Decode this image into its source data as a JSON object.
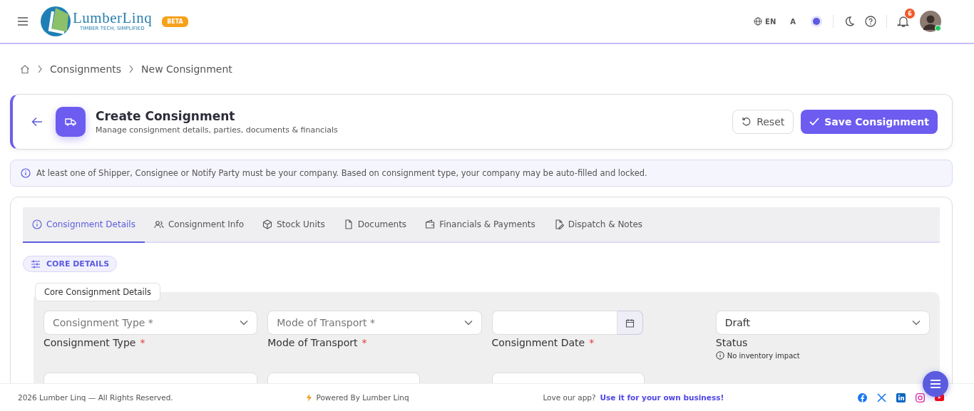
{
  "header": {
    "logo_name": "LumberLinq",
    "logo_tagline": "TIMBER TECH, SIMPLIFIED",
    "badge": "BETA",
    "language": "EN",
    "font_size_label": "A",
    "notifications": "6",
    "avatar_online": true
  },
  "breadcrumb": [
    "Consignments",
    "New Consignment"
  ],
  "page": {
    "title": "Create Consignment",
    "subtitle": "Manage consignment details, parties, documents & financials",
    "buttons": [
      {
        "label": "Reset",
        "kind": "secondary"
      },
      {
        "label": "Save Consignment",
        "kind": "primary"
      }
    ]
  },
  "notice": "At least one of Shipper, Consignee or Notify Party must be your company. Based on consignment type, your company may be auto-filled and locked.",
  "tabs": [
    {
      "label": "Consignment Details",
      "selected": true
    },
    {
      "label": "Consignment Info",
      "selected": false
    },
    {
      "label": "Stock Units",
      "selected": false
    },
    {
      "label": "Documents",
      "selected": false
    },
    {
      "label": "Financials & Payments",
      "selected": false
    },
    {
      "label": "Dispatch & Notes",
      "selected": false
    }
  ],
  "section_chip": "CORE DETAILS",
  "group_title": "Core Consignment Details",
  "fields": [
    {
      "kind": "select",
      "placeholder": "Consignment Type *",
      "label": "Consignment Type",
      "required_mark": "*"
    },
    {
      "kind": "select",
      "placeholder": "Mode of Transport *",
      "label": "Mode of Transport",
      "required_mark": "*"
    },
    {
      "kind": "date",
      "label": "Consignment Date",
      "required_mark": "*"
    },
    {
      "kind": "select",
      "value": "Draft",
      "label": "Status",
      "hint": "No inventory impact"
    }
  ],
  "footer": {
    "copyright": "2026 Lumber Linq — All Rights Reserved.",
    "powered": "Powered By Lumber Linq",
    "promo": "Love our app?",
    "promo_link": "Use it for your own business!"
  }
}
